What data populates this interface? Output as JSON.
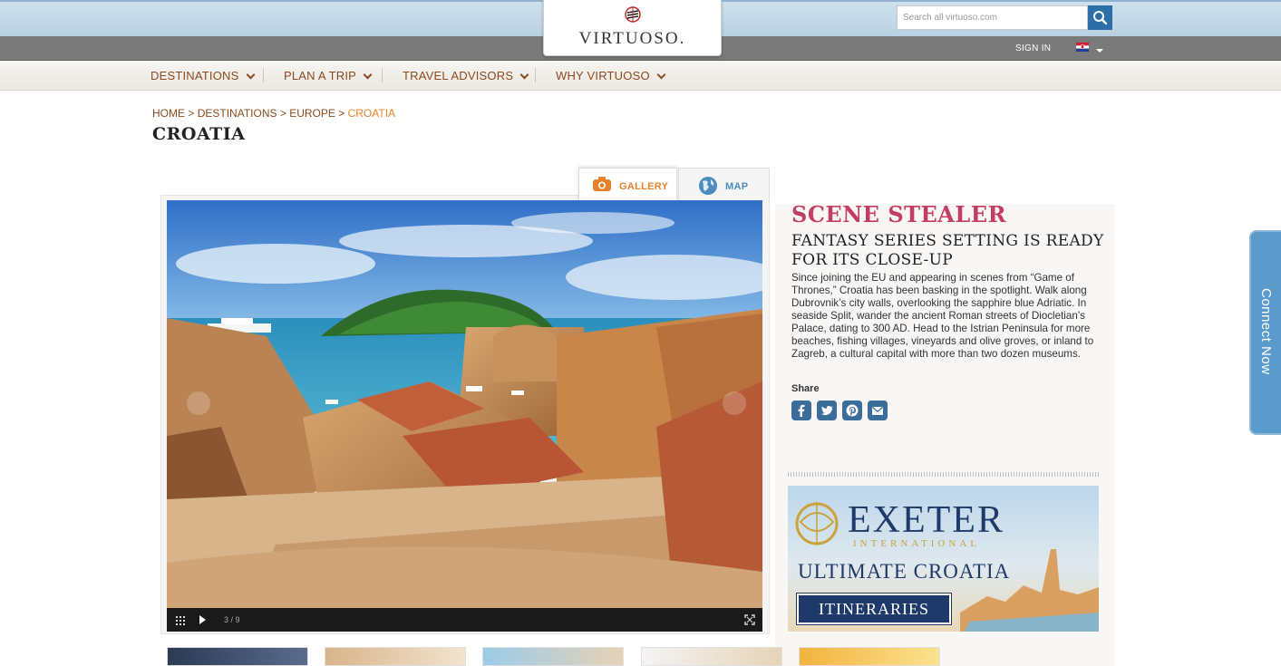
{
  "header": {
    "logo_text": "VIRTUOSO.",
    "search_placeholder": "Search all virtuoso.com",
    "sign_in_label": "SIGN IN"
  },
  "nav": {
    "items": [
      {
        "label": "DESTINATIONS"
      },
      {
        "label": "PLAN A TRIP"
      },
      {
        "label": "TRAVEL ADVISORS"
      },
      {
        "label": "WHY VIRTUOSO"
      }
    ]
  },
  "breadcrumb": {
    "items": [
      "HOME",
      "DESTINATIONS",
      "EUROPE"
    ],
    "separator": ">",
    "current": "CROATIA"
  },
  "page_title": "CROATIA",
  "media_tabs": {
    "gallery_label": "GALLERY",
    "map_label": "MAP"
  },
  "gallery": {
    "counter": "3 / 9"
  },
  "article": {
    "kicker": "SCENE STEALER",
    "headline": "FANTASY SERIES SETTING IS READY FOR ITS CLOSE-UP",
    "body": "Since joining the EU and appearing in scenes from “Game of Thrones,” Croatia has been basking in the spotlight. Walk along Dubrovnik’s city walls, overlooking the sapphire blue Adriatic. In seaside Split, wander the ancient Roman streets of Diocletian’s Palace, dating to 300 AD. Head to the Istrian Peninsula for more beaches, fishing villages, vineyards and olive groves, or inland to Zagreb, a cultural capital with more than two dozen museums.",
    "share_label": "Share",
    "share_icons": [
      "facebook-icon",
      "twitter-icon",
      "pinterest-icon",
      "email-icon"
    ]
  },
  "ad": {
    "brand": "EXETER",
    "brand_sub": "INTERNATIONAL",
    "headline": "ULTIMATE CROATIA",
    "button_label": "ITINERARIES"
  },
  "connect": {
    "label": "Connect Now"
  },
  "colors": {
    "accent_orange": "#e8812c",
    "nav_brown": "#8b4a1e",
    "kicker_pink": "#c43d64",
    "share_blue": "#3a6d99",
    "connect_blue": "#5b9bcb"
  }
}
